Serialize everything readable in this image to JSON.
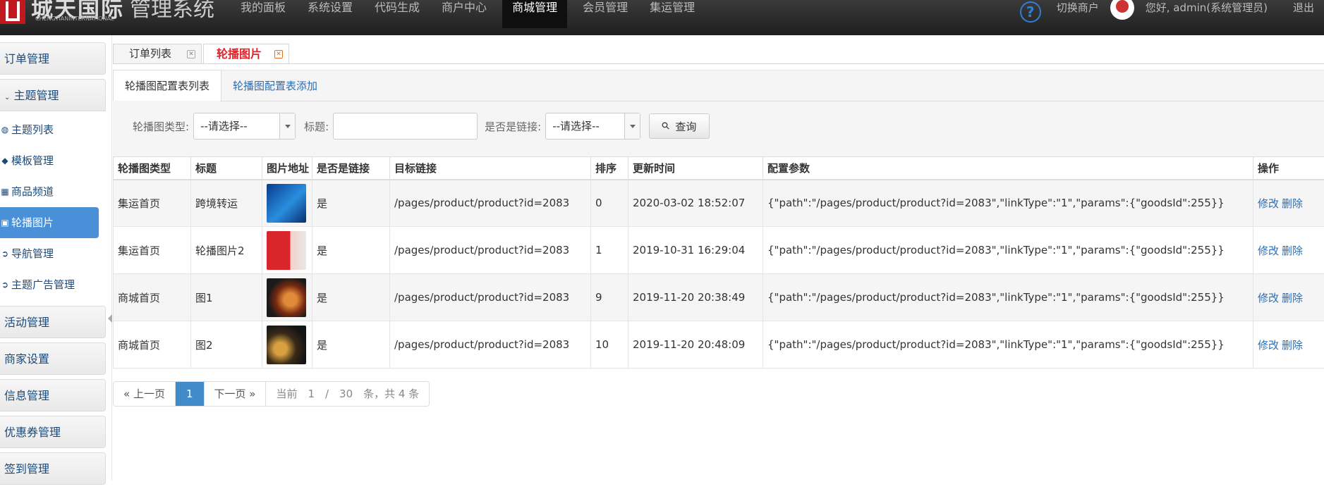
{
  "brand": {
    "name_cn": "城天国际",
    "name_en": "CHENGTIANINTERNATIONAL",
    "system": "管理系统",
    "brand_color": "#c0181f"
  },
  "nav": {
    "items": [
      "我的面板",
      "系统设置",
      "代码生成",
      "商户中心",
      "商城管理",
      "会员管理",
      "集运管理"
    ],
    "active": "商城管理"
  },
  "topright": {
    "help": "?",
    "switch_merchant": "切换商户",
    "greeting": "您好, admin(系统管理员)",
    "logout": "退出"
  },
  "sidebar": {
    "groups": [
      {
        "label": "订单管理"
      },
      {
        "label": "主题管理",
        "open": true,
        "items": [
          {
            "label": "主题列表",
            "icon": "globe-icon"
          },
          {
            "label": "模板管理",
            "icon": "tag-icon"
          },
          {
            "label": "商品频道",
            "icon": "grid-icon"
          },
          {
            "label": "轮播图片",
            "icon": "image-icon",
            "active": true
          },
          {
            "label": "导航管理",
            "icon": "circle-arrow-icon"
          },
          {
            "label": "主题广告管理",
            "icon": "circle-arrow-icon"
          }
        ]
      },
      {
        "label": "活动管理"
      },
      {
        "label": "商家设置"
      },
      {
        "label": "信息管理"
      },
      {
        "label": "优惠券管理"
      },
      {
        "label": "签到管理"
      }
    ]
  },
  "tabs": [
    {
      "label": "订单列表",
      "active": false
    },
    {
      "label": "轮播图片",
      "active": true
    }
  ],
  "subtabs": {
    "list": "轮播图配置表列表",
    "add": "轮播图配置表添加"
  },
  "filters": {
    "type_label": "轮播图类型:",
    "type_value": "--请选择--",
    "title_label": "标题:",
    "title_value": "",
    "link_label": "是否是链接:",
    "link_value": "--请选择--",
    "query_label": "查询"
  },
  "table": {
    "headers": [
      "轮播图类型",
      "标题",
      "图片地址",
      "是否是链接",
      "目标链接",
      "排序",
      "更新时间",
      "配置参数",
      "操作"
    ],
    "rows": [
      {
        "type": "集运首页",
        "title": "跨境转运",
        "link": "是",
        "target": "/pages/product/product?id=2083",
        "sort": "0",
        "updated": "2020-03-02 18:52:07",
        "params": "{\"path\":\"/pages/product/product?id=2083\",\"linkType\":\"1\",\"params\":{\"goodsId\":255}}",
        "edit": "修改",
        "delete": "删除"
      },
      {
        "type": "集运首页",
        "title": "轮播图片2",
        "link": "是",
        "target": "/pages/product/product?id=2083",
        "sort": "1",
        "updated": "2019-10-31 16:29:04",
        "params": "{\"path\":\"/pages/product/product?id=2083\",\"linkType\":\"1\",\"params\":{\"goodsId\":255}}",
        "edit": "修改",
        "delete": "删除"
      },
      {
        "type": "商城首页",
        "title": "图1",
        "link": "是",
        "target": "/pages/product/product?id=2083",
        "sort": "9",
        "updated": "2019-11-20 20:38:49",
        "params": "{\"path\":\"/pages/product/product?id=2083\",\"linkType\":\"1\",\"params\":{\"goodsId\":255}}",
        "edit": "修改",
        "delete": "删除"
      },
      {
        "type": "商城首页",
        "title": "图2",
        "link": "是",
        "target": "/pages/product/product?id=2083",
        "sort": "10",
        "updated": "2019-11-20 20:48:09",
        "params": "{\"path\":\"/pages/product/product?id=2083\",\"linkType\":\"1\",\"params\":{\"goodsId\":255}}",
        "edit": "修改",
        "delete": "删除"
      }
    ]
  },
  "pager": {
    "prev": "« 上一页",
    "current": "1",
    "next": "下一页 »",
    "info": "当前　1　/　30　条，共 4 条"
  },
  "colors": {
    "accent": "#428bca",
    "active_tab": "#e4222a",
    "link": "#2a6fb5"
  }
}
